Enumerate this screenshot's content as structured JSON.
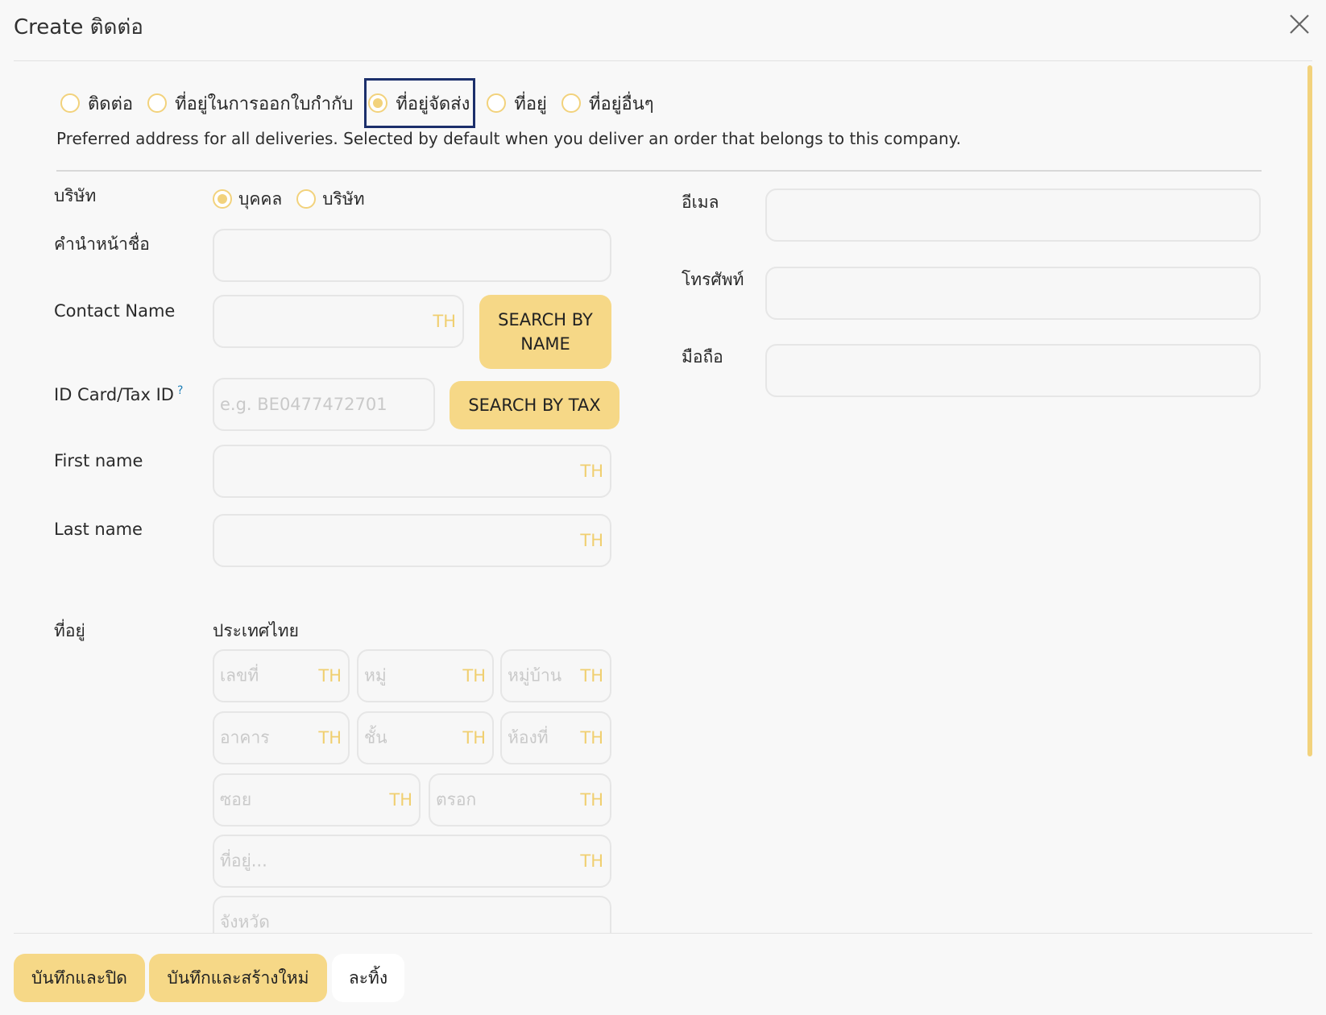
{
  "dialog": {
    "title": "Create ติดต่อ"
  },
  "address_types": {
    "options": [
      "ติดต่อ",
      "ที่อยู่ในการออกใบกำกับ",
      "ที่อยู่จัดส่ง",
      "ที่อยู่",
      "ที่อยู่อื่นๆ"
    ],
    "selected_index": 2,
    "description": "Preferred address for all deliveries. Selected by default when you deliver an order that belongs to this company."
  },
  "form": {
    "company_type_label": "บริษัท",
    "company_type_options": [
      "บุคคล",
      "บริษัท"
    ],
    "title_label": "คำนำหน้าชื่อ",
    "contact_name_label": "Contact Name",
    "search_by_name": "SEARCH BY NAME",
    "tax_id_label": "ID Card/Tax ID",
    "tax_id_help": "?",
    "tax_id_placeholder": "e.g. BE0477472701",
    "search_by_tax": "SEARCH BY TAX",
    "first_name_label": "First name",
    "last_name_label": "Last name",
    "lang_tag": "TH",
    "address_label": "ที่อยู่",
    "country": "ประเทศไทย",
    "address_placeholders": {
      "house_no": "เลขที่",
      "moo": "หมู่",
      "village": "หมู่บ้าน",
      "building": "อาคาร",
      "floor": "ชั้น",
      "room": "ห้องที่",
      "soi": "ซอย",
      "alley": "ตรอก",
      "street": "ที่อยู่...",
      "province": "จังหวัด"
    },
    "email_label": "อีเมล",
    "phone_label": "โทรศัพท์",
    "mobile_label": "มือถือ"
  },
  "footer": {
    "save_close": "บันทึกและปิด",
    "save_new": "บันทึกและสร้างใหม่",
    "discard": "ละทิ้ง"
  },
  "colors": {
    "accent": "#f6d887",
    "focus": "#1c2f6b"
  }
}
